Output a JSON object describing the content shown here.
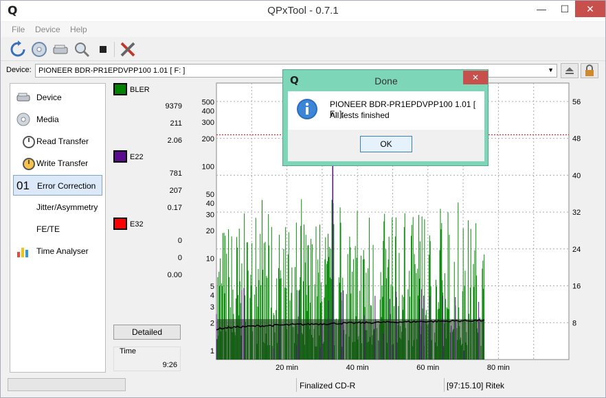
{
  "window": {
    "title": "QPxTool - 0.7.1",
    "logo": "Q"
  },
  "menu": [
    "File",
    "Device",
    "Help"
  ],
  "device": {
    "label": "Device:",
    "value": "PIONEER  BDR-PR1EPDVPP100 1.01 [ F: ]"
  },
  "sidebar": {
    "items": [
      {
        "label": "Device",
        "icon": "drive-icon"
      },
      {
        "label": "Media",
        "icon": "disc-icon"
      },
      {
        "label": "Read Transfer",
        "icon": "stopwatch-icon"
      },
      {
        "label": "Write Transfer",
        "icon": "stopwatch-burst-icon"
      },
      {
        "label": "Error Correction",
        "icon": "error-correction-icon",
        "prefix": "01"
      },
      {
        "label": "Jitter/Asymmetry",
        "icon": ""
      },
      {
        "label": "FE/TE",
        "icon": ""
      },
      {
        "label": "Time Analyser",
        "icon": "bar-chart-icon"
      }
    ]
  },
  "stats": {
    "bler": {
      "name": "BLER",
      "color": "#008000",
      "values": [
        "9379",
        "211",
        "2.06"
      ]
    },
    "e22": {
      "name": "E22",
      "color": "#5a0a8c",
      "values": [
        "781",
        "207",
        "0.17"
      ]
    },
    "e32": {
      "name": "E32",
      "color": "#ff0000",
      "values": [
        "0",
        "0",
        "0.00"
      ]
    },
    "detailed_label": "Detailed",
    "time_label": "Time",
    "time_value": "9:26"
  },
  "chart_data": {
    "type": "bar",
    "series": [
      {
        "name": "BLER",
        "color": "#008000"
      },
      {
        "name": "E22",
        "color": "#5a0a8c"
      },
      {
        "name": "E32",
        "color": "#ff0000"
      },
      {
        "name": "Speed",
        "color": "#000000"
      }
    ],
    "x_ticks": [
      "20 min",
      "40 min",
      "60 min",
      "80 min"
    ],
    "x_tick_values": [
      20,
      40,
      60,
      80
    ],
    "xlim": [
      0,
      100
    ],
    "y_left_ticks": [
      "1",
      "2",
      "3",
      "4",
      "5",
      "10",
      "20",
      "30",
      "40",
      "50",
      "100",
      "200",
      "300",
      "400",
      "500"
    ],
    "y_left_scale": "log",
    "ylim_left": [
      0.8,
      800
    ],
    "y_right_ticks": [
      "8",
      "16",
      "24",
      "32",
      "40",
      "48",
      "56"
    ],
    "ylim_right": [
      0,
      60
    ],
    "threshold_line_value": 220,
    "data_end_min": 76,
    "speed_start": 6.5,
    "speed_end": 8.5,
    "grid": true
  },
  "status": {
    "left": "",
    "middle": "Finalized CD-R",
    "right": "[97:15.10] Ritek"
  },
  "dialog": {
    "title": "Done",
    "close": "✕",
    "message_line1": "PIONEER  BDR-PR1EPDVPP100 1.01 [ F: ]:",
    "message_line2": "All tests finished",
    "ok_label": "OK"
  }
}
